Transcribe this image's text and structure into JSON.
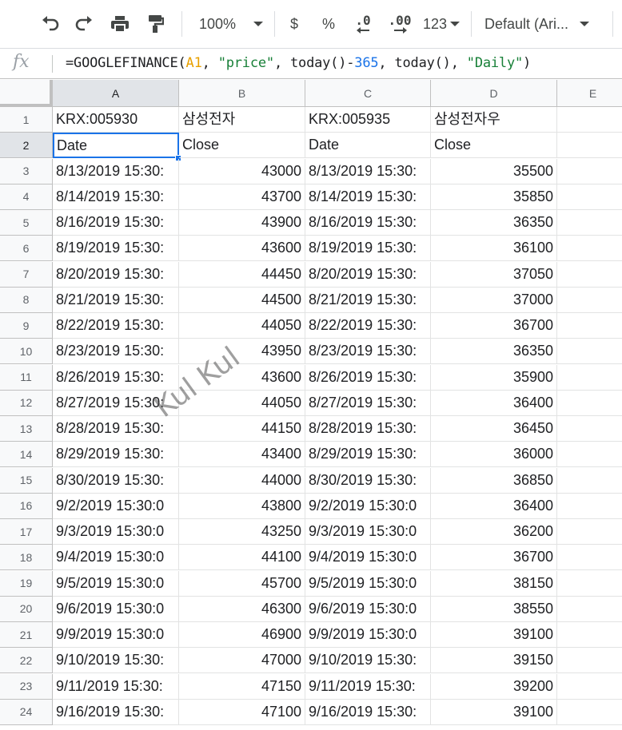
{
  "toolbar": {
    "zoom": "100%",
    "currency_symbol": "$",
    "percent_symbol": "%",
    "decrease_decimal": ".0",
    "increase_decimal": ".00",
    "more_formats": "123",
    "font_name": "Default (Ari..."
  },
  "formula_bar": {
    "fx_label": "fx",
    "formula_parts": [
      {
        "text": "=GOOGLEFINANCE(",
        "kind": "plain"
      },
      {
        "text": "A1",
        "kind": "ref"
      },
      {
        "text": ", ",
        "kind": "plain"
      },
      {
        "text": "\"price\"",
        "kind": "str"
      },
      {
        "text": ", today()-",
        "kind": "plain"
      },
      {
        "text": "365",
        "kind": "num"
      },
      {
        "text": ", today(), ",
        "kind": "plain"
      },
      {
        "text": "\"Daily\"",
        "kind": "str"
      },
      {
        "text": ")",
        "kind": "plain"
      }
    ]
  },
  "columns": [
    "A",
    "B",
    "C",
    "D",
    "E"
  ],
  "selected_column": "A",
  "selected_row": "2",
  "rows": [
    {
      "num": "1",
      "cells": [
        "KRX:005930",
        "삼성전자",
        "KRX:005935",
        "삼성전자우"
      ]
    },
    {
      "num": "2",
      "cells": [
        "Date",
        "Close",
        "Date",
        "Close"
      ]
    },
    {
      "num": "3",
      "cells": [
        "8/13/2019 15:30:",
        "43000",
        "8/13/2019 15:30:",
        "35500"
      ]
    },
    {
      "num": "4",
      "cells": [
        "8/14/2019 15:30:",
        "43700",
        "8/14/2019 15:30:",
        "35850"
      ]
    },
    {
      "num": "5",
      "cells": [
        "8/16/2019 15:30:",
        "43900",
        "8/16/2019 15:30:",
        "36350"
      ]
    },
    {
      "num": "6",
      "cells": [
        "8/19/2019 15:30:",
        "43600",
        "8/19/2019 15:30:",
        "36100"
      ]
    },
    {
      "num": "7",
      "cells": [
        "8/20/2019 15:30:",
        "44450",
        "8/20/2019 15:30:",
        "37050"
      ]
    },
    {
      "num": "8",
      "cells": [
        "8/21/2019 15:30:",
        "44500",
        "8/21/2019 15:30:",
        "37000"
      ]
    },
    {
      "num": "9",
      "cells": [
        "8/22/2019 15:30:",
        "44050",
        "8/22/2019 15:30:",
        "36700"
      ]
    },
    {
      "num": "10",
      "cells": [
        "8/23/2019 15:30:",
        "43950",
        "8/23/2019 15:30:",
        "36350"
      ]
    },
    {
      "num": "11",
      "cells": [
        "8/26/2019 15:30:",
        "43600",
        "8/26/2019 15:30:",
        "35900"
      ]
    },
    {
      "num": "12",
      "cells": [
        "8/27/2019 15:30:",
        "44050",
        "8/27/2019 15:30:",
        "36400"
      ]
    },
    {
      "num": "13",
      "cells": [
        "8/28/2019 15:30:",
        "44150",
        "8/28/2019 15:30:",
        "36450"
      ]
    },
    {
      "num": "14",
      "cells": [
        "8/29/2019 15:30:",
        "43400",
        "8/29/2019 15:30:",
        "36000"
      ]
    },
    {
      "num": "15",
      "cells": [
        "8/30/2019 15:30:",
        "44000",
        "8/30/2019 15:30:",
        "36850"
      ]
    },
    {
      "num": "16",
      "cells": [
        "9/2/2019 15:30:0",
        "43800",
        "9/2/2019 15:30:0",
        "36400"
      ]
    },
    {
      "num": "17",
      "cells": [
        "9/3/2019 15:30:0",
        "43250",
        "9/3/2019 15:30:0",
        "36200"
      ]
    },
    {
      "num": "18",
      "cells": [
        "9/4/2019 15:30:0",
        "44100",
        "9/4/2019 15:30:0",
        "36700"
      ]
    },
    {
      "num": "19",
      "cells": [
        "9/5/2019 15:30:0",
        "45700",
        "9/5/2019 15:30:0",
        "38150"
      ]
    },
    {
      "num": "20",
      "cells": [
        "9/6/2019 15:30:0",
        "46300",
        "9/6/2019 15:30:0",
        "38550"
      ]
    },
    {
      "num": "21",
      "cells": [
        "9/9/2019 15:30:0",
        "46900",
        "9/9/2019 15:30:0",
        "39100"
      ]
    },
    {
      "num": "22",
      "cells": [
        "9/10/2019 15:30:",
        "47000",
        "9/10/2019 15:30:",
        "39150"
      ]
    },
    {
      "num": "23",
      "cells": [
        "9/11/2019 15:30:",
        "47150",
        "9/11/2019 15:30:",
        "39200"
      ]
    },
    {
      "num": "24",
      "cells": [
        "9/16/2019 15:30:",
        "47100",
        "9/16/2019 15:30:",
        "39100"
      ]
    }
  ],
  "watermark": "Kul Kul",
  "colors": {
    "selection": "#1a73e8",
    "formula_ref": "#e8a000",
    "formula_string": "#188038",
    "formula_number": "#1a73e8"
  }
}
